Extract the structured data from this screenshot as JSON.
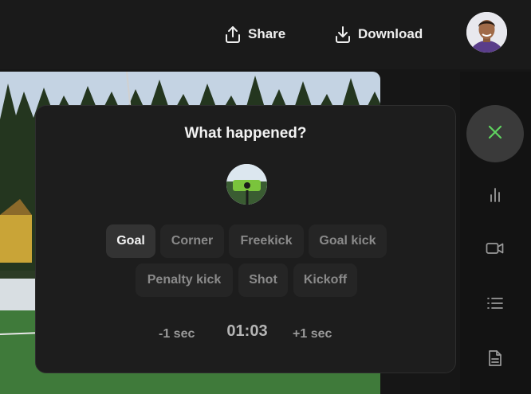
{
  "header": {
    "share_label": "Share",
    "download_label": "Download"
  },
  "dialog": {
    "title": "What happened?",
    "events": [
      {
        "label": "Goal",
        "selected": true
      },
      {
        "label": "Corner",
        "selected": false
      },
      {
        "label": "Freekick",
        "selected": false
      },
      {
        "label": "Goal kick",
        "selected": false
      },
      {
        "label": "Penalty kick",
        "selected": false
      },
      {
        "label": "Shot",
        "selected": false
      },
      {
        "label": "Kickoff",
        "selected": false
      }
    ],
    "time": {
      "minus_label": "-1 sec",
      "value": "01:03",
      "plus_label": "+1 sec"
    }
  },
  "sidebar": {
    "icons": [
      "stats-icon",
      "video-camera-icon",
      "list-icon",
      "document-icon"
    ]
  },
  "colors": {
    "accent_green": "#5fd35f",
    "dialog_bg": "#1d1d1d",
    "chip_bg": "#252525",
    "chip_selected_bg": "#333333"
  }
}
